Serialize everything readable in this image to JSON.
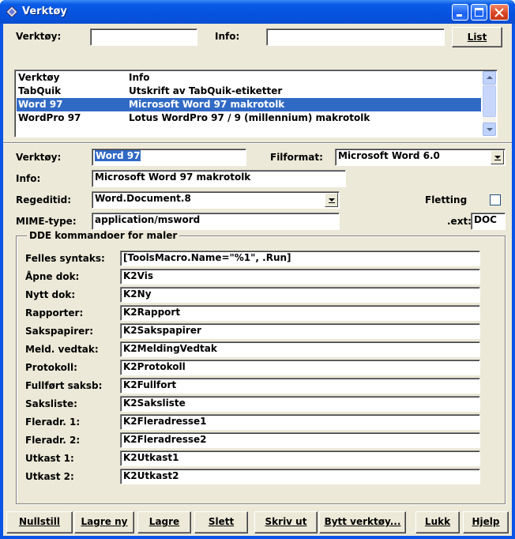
{
  "window": {
    "title": "Verktøy",
    "accent": "#0a54e6"
  },
  "search": {
    "tool_label": "Verktøy:",
    "tool_value": "",
    "info_label": "Info:",
    "info_value": "",
    "list_button": "List"
  },
  "tool_list": {
    "headers": [
      "Verktøy",
      "Info"
    ],
    "rows": [
      {
        "tool": "TabQuik",
        "info": "Utskrift av TabQuik-etiketter",
        "selected": false
      },
      {
        "tool": "Word 97",
        "info": "Microsoft Word 97 makrotolk",
        "selected": true
      },
      {
        "tool": "WordPro 97",
        "info": "Lotus WordPro 97 / 9 (millennium) makrotolk",
        "selected": false
      }
    ]
  },
  "detail": {
    "tool_label": "Verktøy:",
    "tool_value": "Word 97",
    "fileformat_label": "Filformat:",
    "fileformat_value": "Microsoft Word 6.0",
    "info_label": "Info:",
    "info_value": "Microsoft Word 97 makrotolk",
    "regedit_label": "Regeditid:",
    "regedit_value": "Word.Document.8",
    "merge_label": "Fletting",
    "merge_checked": false,
    "mime_label": "MIME-type:",
    "mime_value": "application/msword",
    "ext_label": ".ext:",
    "ext_value": "DOC"
  },
  "dde": {
    "group_title": "DDE kommandoer for maler",
    "fields": [
      {
        "label": "Felles syntaks:",
        "value": "[ToolsMacro.Name=\"%1\", .Run]"
      },
      {
        "label": "Åpne dok:",
        "value": "K2Vis"
      },
      {
        "label": "Nytt dok:",
        "value": "K2Ny"
      },
      {
        "label": "Rapporter:",
        "value": "K2Rapport"
      },
      {
        "label": "Sakspapirer:",
        "value": "K2Sakspapirer"
      },
      {
        "label": "Meld. vedtak:",
        "value": "K2MeldingVedtak"
      },
      {
        "label": "Protokoll:",
        "value": "K2Protokoll"
      },
      {
        "label": "Fullført saksb:",
        "value": "K2Fullfort"
      },
      {
        "label": "Saksliste:",
        "value": "K2Saksliste"
      },
      {
        "label": "Fleradr. 1:",
        "value": "K2Fleradresse1"
      },
      {
        "label": "Fleradr. 2:",
        "value": "K2Fleradresse2"
      },
      {
        "label": "Utkast 1:",
        "value": "K2Utkast1"
      },
      {
        "label": "Utkast 2:",
        "value": "K2Utkast2"
      }
    ]
  },
  "buttons": {
    "reset": "Nullstill",
    "save_new": "Lagre ny",
    "save": "Lagre",
    "delete": "Slett",
    "print": "Skriv ut",
    "swap_tool": "Bytt verktøy...",
    "close": "Lukk",
    "help": "Hjelp"
  }
}
